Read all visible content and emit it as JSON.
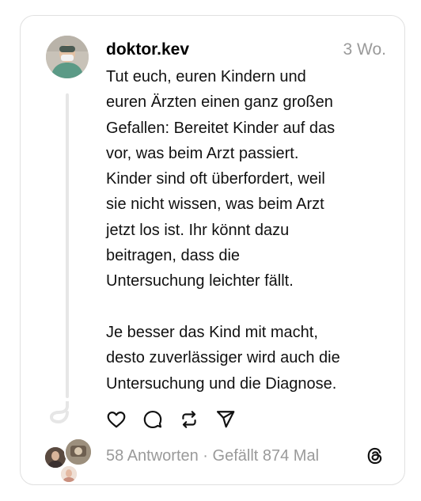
{
  "post": {
    "username": "doktor.kev",
    "time": "3 Wo.",
    "paragraphs": [
      "Tut euch, euren Kindern und\neuren Ärzten einen ganz großen\nGefallen: Bereitet Kinder auf das\nvor, was beim Arzt passiert.\nKinder sind oft überfordert, weil\nsie nicht wissen, was beim Arzt\njetzt los ist. Ihr könnt dazu\nbeitragen, dass die\nUntersuchung leichter fällt.",
      "Je besser das Kind mit macht,\ndesto zuverlässiger wird auch die\nUntersuchung und die Diagnose."
    ],
    "stats": "58 Antworten · Gefällt 874 Mal"
  },
  "actions": [
    {
      "icon": "heart-icon"
    },
    {
      "icon": "comment-icon"
    },
    {
      "icon": "repost-icon"
    },
    {
      "icon": "share-icon"
    }
  ],
  "colors": {
    "text": "#111111",
    "muted": "#9a9a9a",
    "border": "#e0e0e0",
    "thread_line": "#e6e6e6"
  }
}
